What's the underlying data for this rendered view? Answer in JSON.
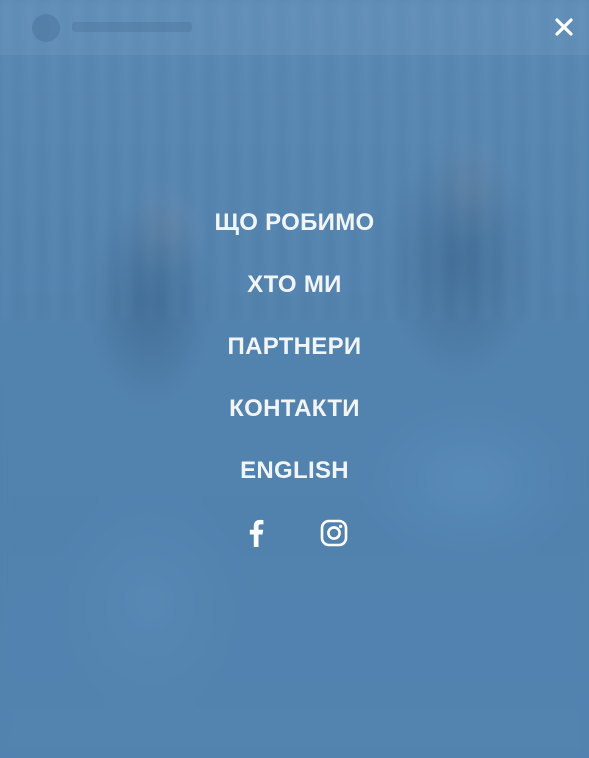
{
  "menu": {
    "items": [
      {
        "label": "ЩО РОБИМО"
      },
      {
        "label": "ХТО МИ"
      },
      {
        "label": "ПАРТНЕРИ"
      },
      {
        "label": "КОНТАКТИ"
      },
      {
        "label": "ENGLISH"
      }
    ]
  },
  "social": {
    "icons": [
      "facebook-icon",
      "instagram-icon"
    ]
  },
  "controls": {
    "close_icon": "close-icon"
  },
  "colors": {
    "overlay": "#5a88b2",
    "text": "#f2f5f8"
  }
}
